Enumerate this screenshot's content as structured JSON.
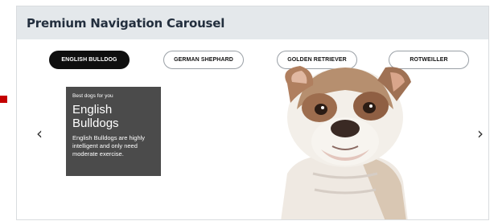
{
  "header": {
    "title": "Premium Navigation Carousel"
  },
  "tabs": [
    {
      "label": "ENGLISH BULLDOG",
      "active": true
    },
    {
      "label": "GERMAN SHEPHARD",
      "active": false
    },
    {
      "label": "GOLDEN RETRIEVER",
      "active": false
    },
    {
      "label": "ROTWEILLER",
      "active": false
    }
  ],
  "nav": {
    "prev_glyph": "‹",
    "next_glyph": "›"
  },
  "card": {
    "eyebrow": "Best dogs for you",
    "title": "English Bulldogs",
    "body": "English Bulldogs are highly intelligent and only need moderate exercise."
  },
  "colors": {
    "header_bg": "#e4e8eb",
    "active_tab": "#0f0f0f",
    "card_bg": "#4b4b4b",
    "marker": "#c40000"
  }
}
